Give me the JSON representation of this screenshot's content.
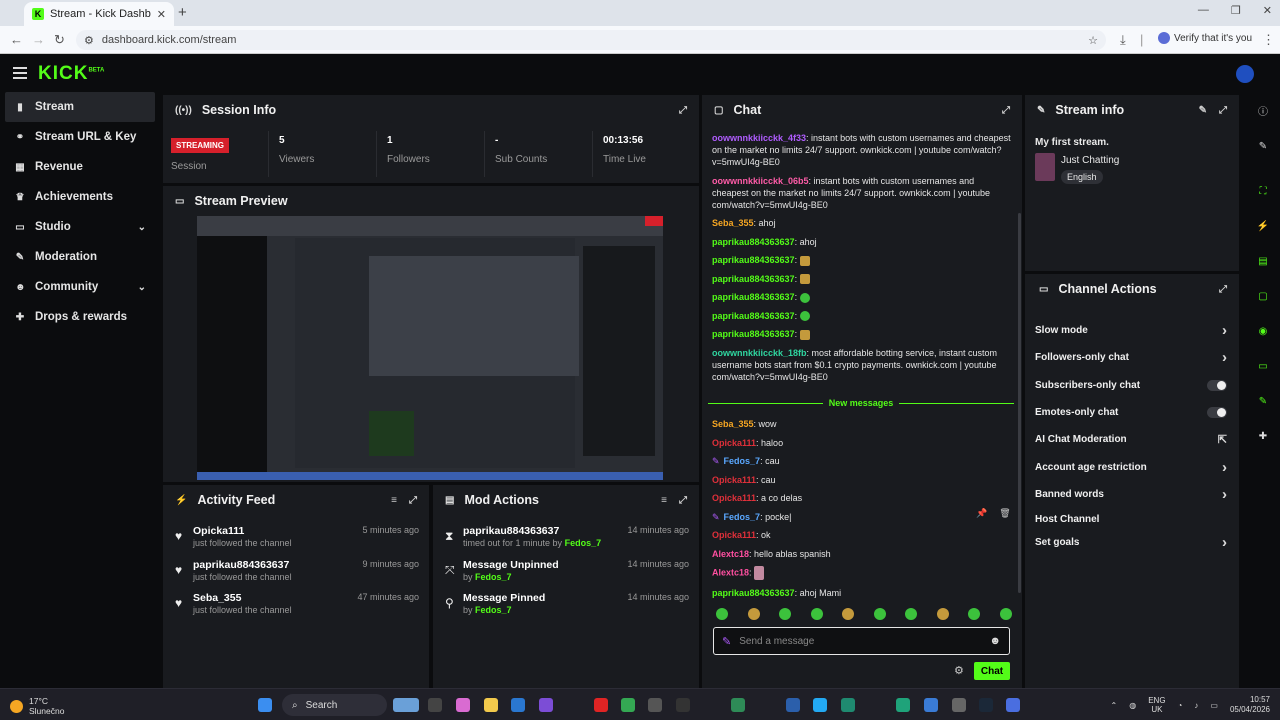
{
  "browser": {
    "tab_title": "Stream - Kick Dashboard",
    "tab_favicon": "K",
    "url": "dashboard.kick.com/stream",
    "verify_text": "Verify that it's you"
  },
  "brand": {
    "logo": "KICK",
    "logo_sup": "BETA",
    "accent": "#53fc18"
  },
  "sidebar": {
    "items": [
      {
        "label": "Stream",
        "icon": "broadcast-icon",
        "glyph": "▮",
        "active": true
      },
      {
        "label": "Stream URL & Key",
        "icon": "link-icon",
        "glyph": "⚭"
      },
      {
        "label": "Revenue",
        "icon": "chart-icon",
        "glyph": "▦"
      },
      {
        "label": "Achievements",
        "icon": "trophy-icon",
        "glyph": "♛"
      },
      {
        "label": "Studio",
        "icon": "tv-icon",
        "glyph": "▭",
        "expandable": true
      },
      {
        "label": "Moderation",
        "icon": "wrench-icon",
        "glyph": "✎"
      },
      {
        "label": "Community",
        "icon": "people-icon",
        "glyph": "☻",
        "expandable": true
      },
      {
        "label": "Drops & rewards",
        "icon": "gift-icon",
        "glyph": "✚"
      }
    ]
  },
  "session": {
    "title": "Session Info",
    "status": "STREAMING",
    "status_label": "Session",
    "stats": [
      {
        "value": "5",
        "label": "Viewers"
      },
      {
        "value": "1",
        "label": "Followers"
      },
      {
        "value": "-",
        "label": "Sub Counts"
      },
      {
        "value": "00:13:56",
        "label": "Time Live"
      }
    ]
  },
  "preview": {
    "title": "Stream Preview"
  },
  "activity": {
    "title": "Activity Feed",
    "items": [
      {
        "name": "Opicka111",
        "sub": "just followed the channel",
        "time": "5 minutes ago"
      },
      {
        "name": "paprikau884363637",
        "sub": "just followed the channel",
        "time": "9 minutes ago"
      },
      {
        "name": "Seba_355",
        "sub": "just followed the channel",
        "time": "47 minutes ago"
      }
    ]
  },
  "mod": {
    "title": "Mod Actions",
    "items": [
      {
        "name": "paprikau884363637",
        "sub": "timed out for 1 minute by",
        "by": "Fedos_7",
        "time": "14 minutes ago",
        "glyph": "⧗"
      },
      {
        "name": "Message Unpinned",
        "sub": "by",
        "by": "Fedos_7",
        "time": "14 minutes ago",
        "glyph": "⤧"
      },
      {
        "name": "Message Pinned",
        "sub": "by",
        "by": "Fedos_7",
        "time": "14 minutes ago",
        "glyph": "⚲"
      }
    ]
  },
  "chat": {
    "title": "Chat",
    "messages": [
      {
        "user": "oowwnnkkiicckk_4f33",
        "color": "#b05cff",
        "text": ": instant bots with custom usernames and cheapest on the market no limits 24/7 support. ownkick.com | youtube com/watch?v=5mwUI4g-BE0"
      },
      {
        "user": "oowwnnkkiicckk_06b5",
        "color": "#ff5ca8",
        "text": ": instant bots with custom usernames and cheapest on the market no limits 24/7 support. ownkick.com | youtube com/watch?v=5mwUI4g-BE0"
      },
      {
        "user": "Seba_355",
        "color": "#f5a623",
        "text": ": ahoj"
      },
      {
        "user": "paprikau884363637",
        "color": "#53fc18",
        "text": ": ahoj"
      },
      {
        "user": "paprikau884363637",
        "color": "#53fc18",
        "text": ": ",
        "emote": "y"
      },
      {
        "user": "paprikau884363637",
        "color": "#53fc18",
        "text": ": ",
        "emote": "y"
      },
      {
        "user": "paprikau884363637",
        "color": "#53fc18",
        "text": ": ",
        "emote": "g"
      },
      {
        "user": "paprikau884363637",
        "color": "#53fc18",
        "text": ": ",
        "emote": "g"
      },
      {
        "user": "paprikau884363637",
        "color": "#53fc18",
        "text": ": ",
        "emote": "y"
      },
      {
        "user": "oowwnnkkiicckk_18fb",
        "color": "#2fd6a0",
        "text": ": most affordable botting service, instant custom username bots start from $0.1 crypto payments. ownkick.com | youtube com/watch?v=5mwUI4g-BE0"
      }
    ],
    "new_label": "New messages",
    "new_messages": [
      {
        "user": "Seba_355",
        "color": "#f5a623",
        "text": ": wow"
      },
      {
        "user": "Opicka111",
        "color": "#e0303a",
        "text": ": haloo"
      },
      {
        "user": "Fedos_7",
        "color": "#5aa8ff",
        "text": ": cau",
        "mod": true
      },
      {
        "user": "Opicka111",
        "color": "#e0303a",
        "text": ": cau"
      },
      {
        "user": "Opicka111",
        "color": "#e0303a",
        "text": ": a co delas"
      },
      {
        "user": "Fedos_7",
        "color": "#5aa8ff",
        "text": ": pocke|",
        "mod": true
      },
      {
        "user": "Opicka111",
        "color": "#e0303a",
        "text": ": ok"
      },
      {
        "user": "Alextc18",
        "color": "#ff4fa0",
        "text": ": hello ablas spanish"
      },
      {
        "user": "Alextc18",
        "color": "#ff4fa0",
        "text": ": ",
        "emote": "p"
      },
      {
        "user": "paprikau884363637",
        "color": "#53fc18",
        "text": ": ahoj Mami"
      }
    ],
    "placeholder": "Send a message",
    "send_label": "Chat"
  },
  "stream_info": {
    "title": "Stream info",
    "stream_title": "My first stream.",
    "category": "Just Chatting",
    "language": "English"
  },
  "channel_actions": {
    "title": "Channel Actions",
    "items": [
      {
        "label": "Slow mode",
        "ctl": "chevron"
      },
      {
        "label": "Followers-only chat",
        "ctl": "chevron"
      },
      {
        "label": "Subscribers-only chat",
        "ctl": "toggle"
      },
      {
        "label": "Emotes-only chat",
        "ctl": "toggle"
      },
      {
        "label": "AI Chat Moderation",
        "ctl": "external"
      },
      {
        "label": "Account age restriction",
        "ctl": "chevron"
      },
      {
        "label": "Banned words",
        "ctl": "chevron"
      },
      {
        "label": "Host Channel",
        "ctl": "none"
      },
      {
        "label": "Set goals",
        "ctl": "chevron"
      }
    ]
  },
  "taskbar": {
    "temp": "17°C",
    "weather": "Slunečno",
    "search": "Search",
    "lang1": "ENG",
    "lang2": "UK",
    "time": "10:57",
    "date": "05/04/2026"
  }
}
